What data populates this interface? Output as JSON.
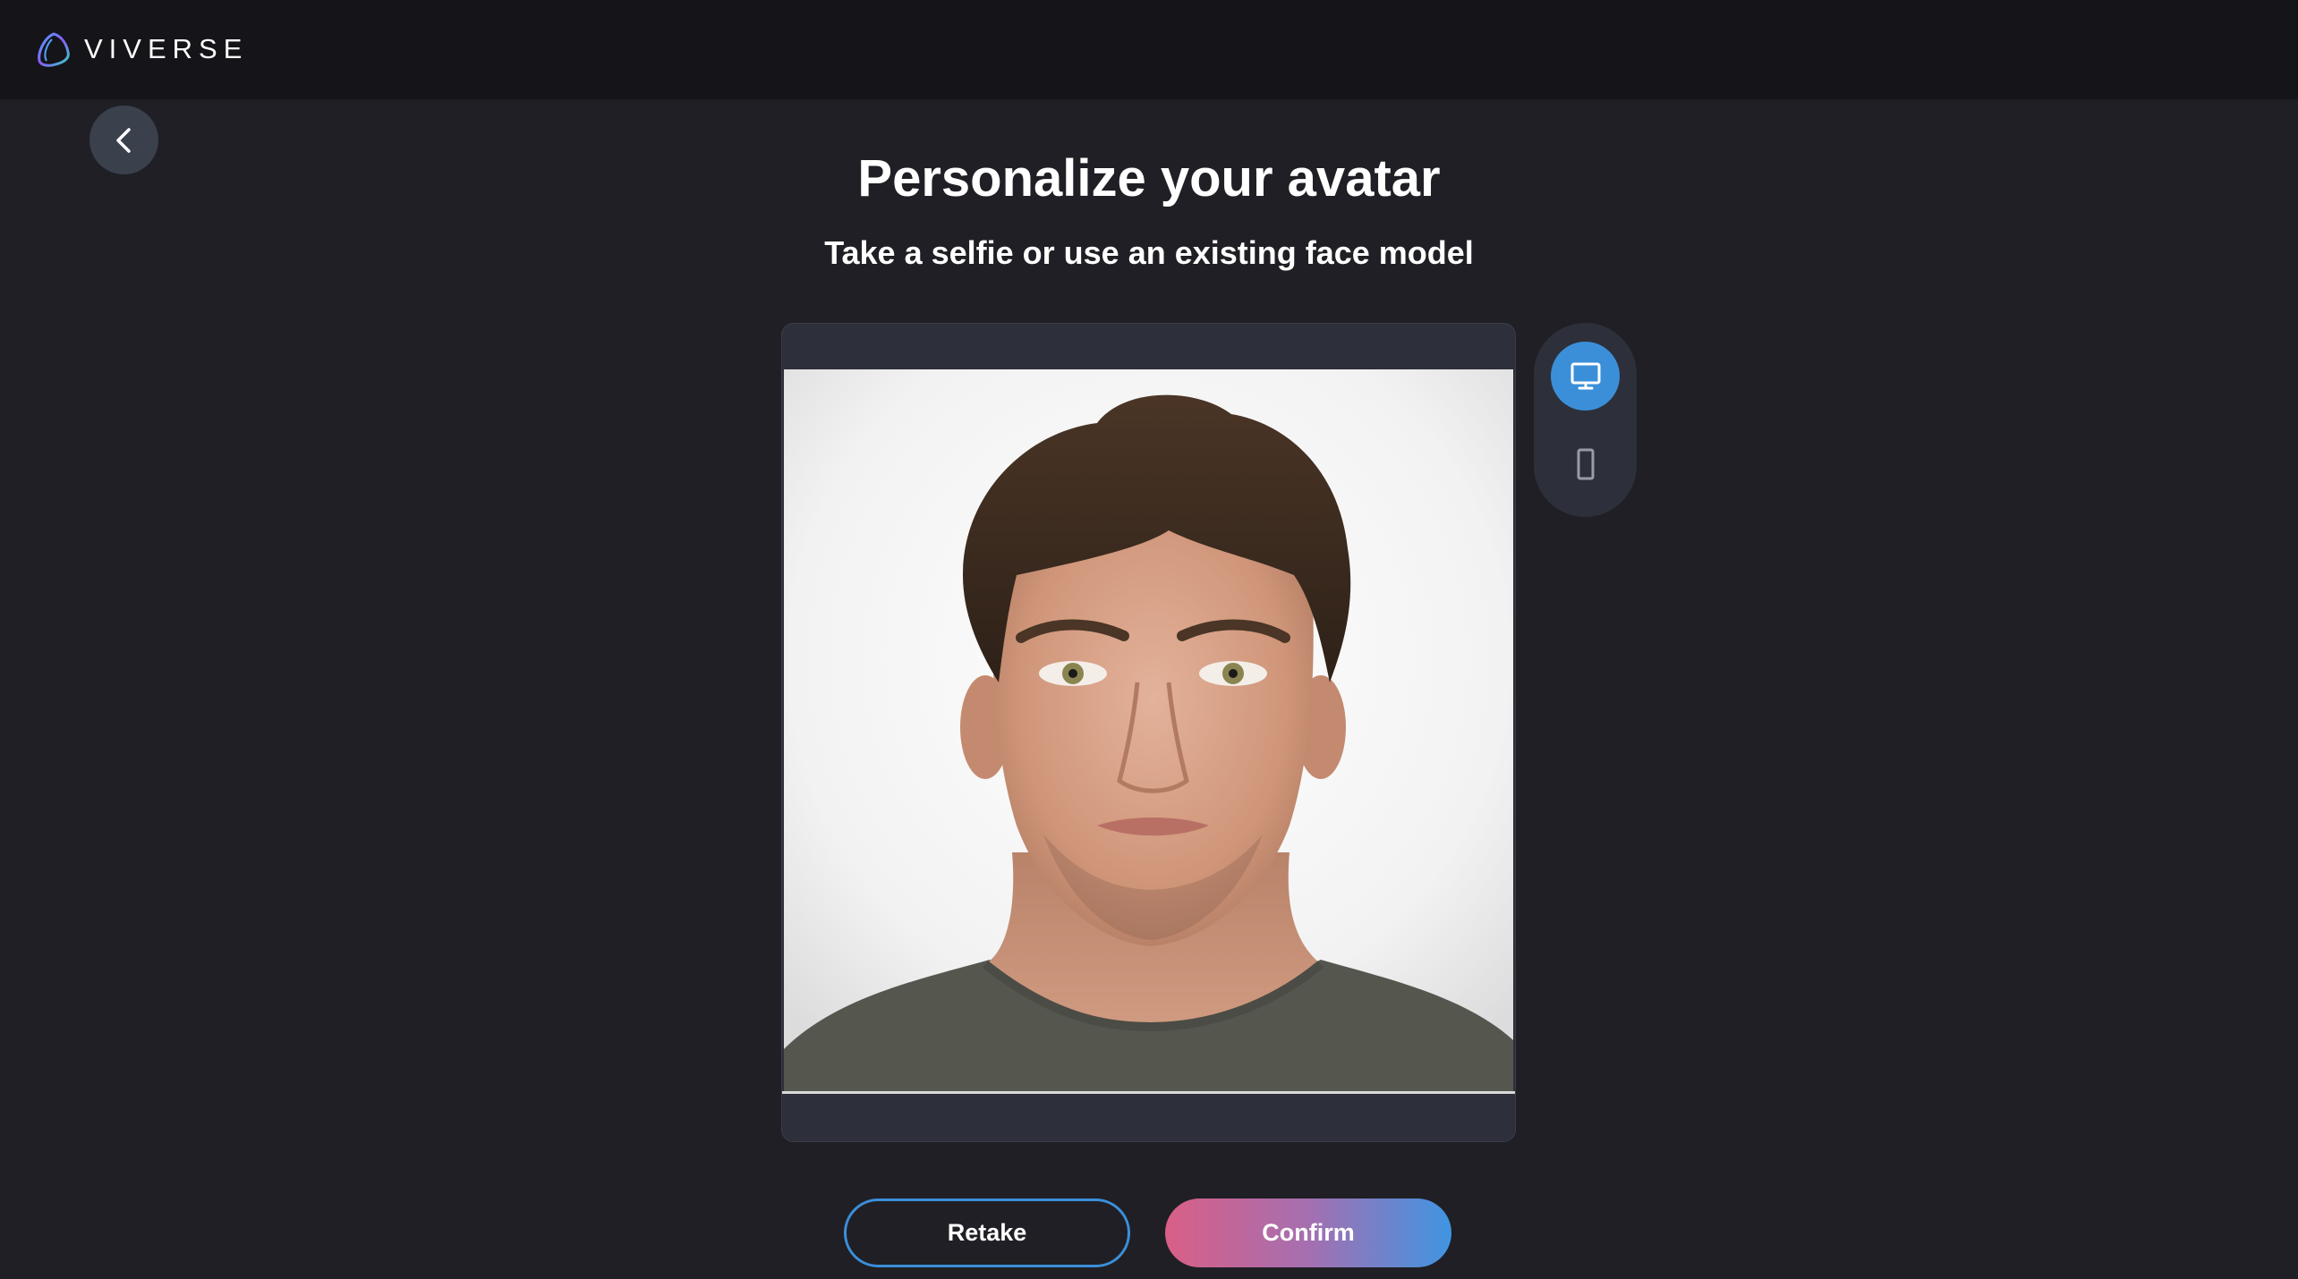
{
  "header": {
    "brand": "VIVERSE",
    "logo_icon": "viverse-logo-icon"
  },
  "nav": {
    "back_icon": "chevron-left-icon"
  },
  "main": {
    "title": "Personalize your avatar",
    "subtitle": "Take a selfie or use an existing face model"
  },
  "preview": {
    "photo": "face-photo"
  },
  "device_switch": {
    "options": [
      {
        "icon": "monitor-icon",
        "active": true
      },
      {
        "icon": "phone-icon",
        "active": false
      }
    ]
  },
  "actions": {
    "retake_label": "Retake",
    "confirm_label": "Confirm"
  },
  "colors": {
    "background": "#1f1f25",
    "topbar": "#141419",
    "panel": "#2d303a",
    "accent_blue": "#3b8fd9",
    "gradient_pink": "#d95f86",
    "gradient_blue": "#3f95e2"
  }
}
